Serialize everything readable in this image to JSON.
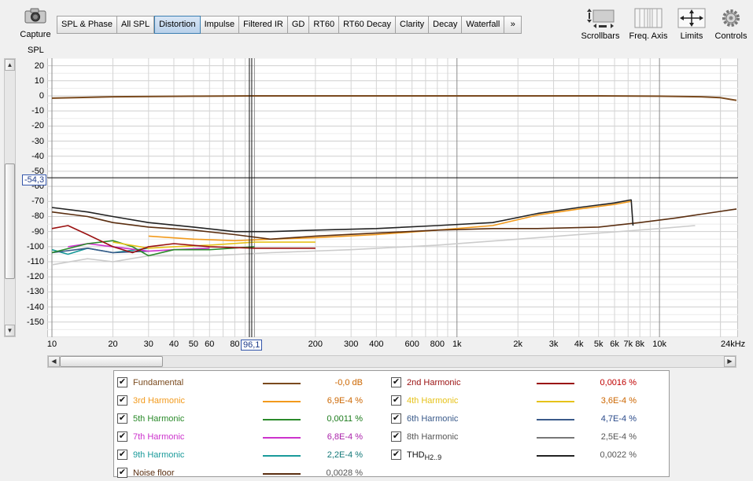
{
  "capture_label": "Capture",
  "tabs": [
    "SPL & Phase",
    "All SPL",
    "Distortion",
    "Impulse",
    "Filtered IR",
    "GD",
    "RT60",
    "RT60 Decay",
    "Clarity",
    "Decay",
    "Waterfall",
    "»"
  ],
  "active_tab": "Distortion",
  "tools": {
    "scrollbars": "Scrollbars",
    "freq_axis": "Freq. Axis",
    "limits": "Limits",
    "controls": "Controls"
  },
  "y_axis_label": "SPL",
  "x_axis_unit": "kHz",
  "cursor": {
    "y_value": "-54,3",
    "x_value": "96,1"
  },
  "legend": {
    "left": [
      {
        "name": "Fundamental",
        "value": "-0,0 dB",
        "color": "#7a4a1e"
      },
      {
        "name": "3rd Harmonic",
        "value": "6,9E-4 %",
        "color": "#f29a1c"
      },
      {
        "name": "5th Harmonic",
        "value": "0,0011 %",
        "color": "#2a8a2a"
      },
      {
        "name": "7th Harmonic",
        "value": "6,8E-4 %",
        "color": "#cc33cc"
      },
      {
        "name": "9th Harmonic",
        "value": "2,2E-4 %",
        "color": "#1a9a9a"
      },
      {
        "name": "Noise floor",
        "value": "0,0028 %",
        "color": "#5a2e10"
      }
    ],
    "right": [
      {
        "name": "2nd Harmonic",
        "value": "0,0016 %",
        "color": "#9a1010"
      },
      {
        "name": "4th Harmonic",
        "value": "3,6E-4 %",
        "color": "#e6c21a"
      },
      {
        "name": "6th Harmonic",
        "value": "4,7E-4 %",
        "color": "#3a5a8a"
      },
      {
        "name": "8th Harmonic",
        "value": "2,5E-4 %",
        "color": "#777777"
      },
      {
        "name": "THD",
        "sub": "H2..9",
        "value": "0,0022 %",
        "color": "#222222"
      }
    ]
  },
  "chart_data": {
    "type": "line",
    "ylabel": "SPL",
    "xlabel": "",
    "x_scale": "log",
    "xlim": [
      10,
      24000
    ],
    "ylim": [
      -160,
      25
    ],
    "y_ticks": [
      20,
      10,
      0,
      -10,
      -20,
      -30,
      -40,
      -50,
      -60,
      -70,
      -80,
      -90,
      -100,
      -110,
      -120,
      -130,
      -140,
      -150
    ],
    "x_ticks": [
      {
        "v": 10,
        "l": "10"
      },
      {
        "v": 20,
        "l": "20"
      },
      {
        "v": 30,
        "l": "30"
      },
      {
        "v": 40,
        "l": "40"
      },
      {
        "v": 50,
        "l": "50"
      },
      {
        "v": 60,
        "l": "60"
      },
      {
        "v": 80,
        "l": "80"
      },
      {
        "v": 200,
        "l": "200"
      },
      {
        "v": 300,
        "l": "300"
      },
      {
        "v": 400,
        "l": "400"
      },
      {
        "v": 600,
        "l": "600"
      },
      {
        "v": 800,
        "l": "800"
      },
      {
        "v": 1000,
        "l": "1k"
      },
      {
        "v": 2000,
        "l": "2k"
      },
      {
        "v": 3000,
        "l": "3k"
      },
      {
        "v": 4000,
        "l": "4k"
      },
      {
        "v": 5000,
        "l": "5k"
      },
      {
        "v": 6000,
        "l": "6k"
      },
      {
        "v": 7000,
        "l": "7k"
      },
      {
        "v": 8000,
        "l": "8k"
      },
      {
        "v": 10000,
        "l": "10k"
      },
      {
        "v": 24000,
        "l": "24kHz"
      }
    ],
    "grid": true,
    "cursor": {
      "x": 96.1,
      "y": -54.3
    },
    "series": [
      {
        "name": "Fundamental",
        "color": "#7a4a1e",
        "x": [
          10,
          20,
          50,
          100,
          1000,
          5000,
          10000,
          16000,
          20000,
          24000
        ],
        "y": [
          -1.5,
          -0.6,
          -0.2,
          0,
          0,
          0,
          -0.2,
          -0.6,
          -1.2,
          -3
        ]
      },
      {
        "name": "Noise floor",
        "color": "#5a2e10",
        "x": [
          10,
          15,
          20,
          30,
          50,
          80,
          120,
          200,
          400,
          800,
          1500,
          2500,
          5000,
          8000,
          12000,
          24000
        ],
        "y": [
          -77,
          -80,
          -84,
          -87,
          -89,
          -92,
          -95,
          -93,
          -91,
          -89,
          -88,
          -88,
          -87,
          -84,
          -81,
          -75
        ]
      },
      {
        "name": "THD",
        "color": "#222222",
        "x": [
          10,
          15,
          20,
          30,
          50,
          80,
          120,
          200,
          400,
          800,
          1500,
          2500,
          4000,
          6000,
          7200,
          7250,
          7400
        ],
        "y": [
          -74,
          -77,
          -80,
          -84,
          -87,
          -90,
          -90,
          -89,
          -88,
          -86,
          -84,
          -78,
          -74,
          -71,
          -69,
          -69,
          -86
        ]
      },
      {
        "name": "3rd Harmonic",
        "color": "#f29a1c",
        "x": [
          30,
          50,
          80,
          120,
          200,
          400,
          800,
          1500,
          2500,
          4000,
          6000,
          7200
        ],
        "y": [
          -93,
          -95,
          -96,
          -95,
          -94,
          -92,
          -89,
          -86,
          -79,
          -75,
          -72,
          -70
        ]
      },
      {
        "name": "2nd Harmonic",
        "color": "#9a1010",
        "x": [
          10,
          12,
          15,
          20,
          25,
          30,
          40,
          60,
          100,
          200
        ],
        "y": [
          -88,
          -86,
          -92,
          -100,
          -104,
          -100,
          -98,
          -100,
          -101,
          -101
        ]
      },
      {
        "name": "5th Harmonic",
        "color": "#2a8a2a",
        "x": [
          10,
          15,
          20,
          25,
          30,
          40,
          60,
          100
        ],
        "y": [
          -104,
          -98,
          -96,
          -100,
          -106,
          -102,
          -102,
          -100
        ]
      },
      {
        "name": "7th Harmonic",
        "color": "#cc33cc",
        "x": [
          12,
          15,
          20,
          30,
          40,
          60
        ],
        "y": [
          -100,
          -98,
          -100,
          -103,
          -102,
          -101
        ]
      },
      {
        "name": "9th Harmonic",
        "color": "#1a9a9a",
        "x": [
          10,
          12,
          15,
          20,
          30
        ],
        "y": [
          -102,
          -105,
          -101,
          -104,
          -101
        ]
      },
      {
        "name": "4th Harmonic",
        "color": "#e6c21a",
        "x": [
          20,
          30,
          40,
          60,
          100,
          200
        ],
        "y": [
          -97,
          -101,
          -100,
          -99,
          -97,
          -97
        ]
      },
      {
        "name": "6th Harmonic",
        "color": "#3a5a8a",
        "x": [
          10,
          15,
          20,
          30
        ],
        "y": [
          -104,
          -101,
          -104,
          -103
        ]
      },
      {
        "name": "8th Harmonic",
        "color": "#cccccc",
        "x": [
          10,
          15,
          20,
          30,
          60,
          120,
          300,
          800,
          2000,
          5000,
          10000,
          15000
        ],
        "y": [
          -112,
          -108,
          -110,
          -106,
          -106,
          -104,
          -102,
          -99,
          -95,
          -91,
          -88,
          -86
        ]
      }
    ]
  }
}
